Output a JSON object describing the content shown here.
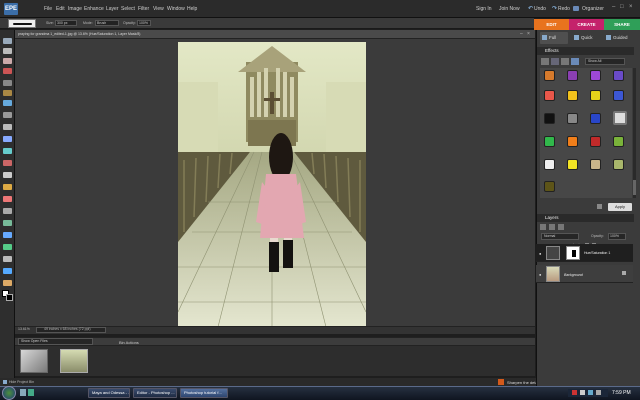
{
  "menubar": {
    "logo": "EPE",
    "items": [
      "File",
      "Edit",
      "Image",
      "Enhance",
      "Layer",
      "Select",
      "Filter",
      "View",
      "Window",
      "Help"
    ],
    "right": [
      "Sign In",
      "Join Now",
      "Undo",
      "Redo",
      "Organizer"
    ]
  },
  "options_bar": {
    "size_label": "Size:",
    "size_value": "300 px",
    "mode_label": "Mode:",
    "mode_value": "Brush",
    "opacity_label": "Opacity:",
    "opacity_value": "100%"
  },
  "mode_tabs": [
    "EDIT",
    "CREATE",
    "SHARE"
  ],
  "document": {
    "title": "praying for grandma 1_edited-1.jpg @ 13.6% (Hue/Saturation 1, Layer Mask/8)",
    "zoom": "13.61%",
    "size_info": "49 inches x 68 inches (72 ppi)"
  },
  "bin": {
    "show_label": "Show Open Files",
    "actions_label": "Bin Actions",
    "hide_label": "Hide Project Bin"
  },
  "edit_tabs": [
    "Full",
    "Quick",
    "Guided"
  ],
  "effects": {
    "title": "Effects",
    "show_label": "Show All",
    "apply_label": "Apply"
  },
  "layers": {
    "title": "Layers",
    "blend": "Normal",
    "opacity_label": "Opacity:",
    "opacity_value": "100%",
    "lock_label": "Lock:",
    "items": [
      "Hue/Saturation 1",
      "Background"
    ]
  },
  "tip": "Sharpen the details",
  "taskbar": {
    "items": [
      "Maya and Odessa - ...",
      "Editor - Photoshop ...",
      "Photoshop tutorial f..."
    ],
    "clock": "7:59 PM"
  },
  "colors": {
    "edit_tab": "#e8731e",
    "create_tab": "#c4226b",
    "share_tab": "#2f9f58"
  }
}
